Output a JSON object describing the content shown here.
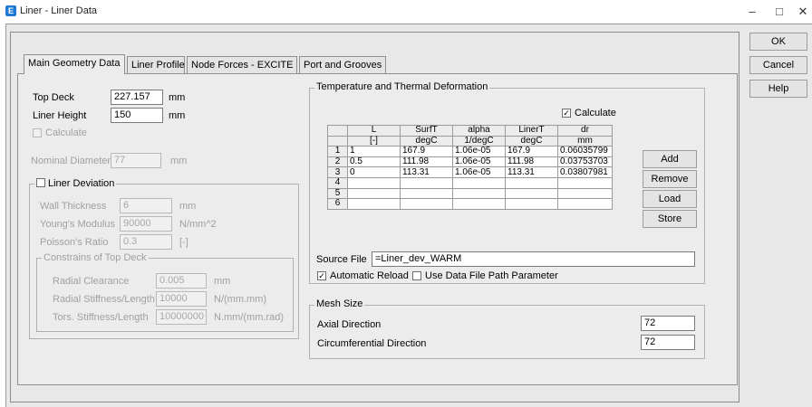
{
  "window": {
    "title": "Liner - Liner Data",
    "app_icon": "E",
    "controls": [
      "–",
      "□",
      "✕"
    ]
  },
  "side_buttons": {
    "ok": "OK",
    "cancel": "Cancel",
    "help": "Help"
  },
  "tabs": [
    "Main Geometry Data",
    "Liner Profile",
    "Node Forces - EXCITE",
    "Port and Grooves"
  ],
  "geometry": {
    "top_deck": {
      "label": "Top Deck",
      "value": "227.157",
      "unit": "mm"
    },
    "liner_height": {
      "label": "Liner Height",
      "value": "150",
      "unit": "mm"
    },
    "calculate": {
      "label": "Calculate"
    },
    "nominal_diameter": {
      "label": "Nominal Diameter",
      "value": "77",
      "unit": "mm"
    }
  },
  "liner_deviation": {
    "title": "Liner Deviation",
    "wall_thickness": {
      "label": "Wall Thickness",
      "value": "6",
      "unit": "mm"
    },
    "youngs_modulus": {
      "label": "Young's Modulus",
      "value": "90000",
      "unit": "N/mm^2"
    },
    "poissons_ratio": {
      "label": "Poisson's Ratio",
      "value": "0.3",
      "unit": "[-]"
    },
    "constraints": {
      "title": "Constrains of Top Deck",
      "radial_clearance": {
        "label": "Radial Clearance",
        "value": "0.005",
        "unit": "mm"
      },
      "radial_stiffness": {
        "label": "Radial Stiffness/Length",
        "value": "10000",
        "unit": "N/(mm.mm)"
      },
      "tors_stiffness": {
        "label": "Tors. Stiffness/Length",
        "value": "10000000",
        "unit": "N.mm/(mm.rad)"
      }
    }
  },
  "thermal": {
    "title": "Temperature and Thermal Deformation",
    "calculate_label": "Calculate",
    "calculate_checked": true,
    "columns": [
      {
        "name": "L",
        "unit": "[-]"
      },
      {
        "name": "SurfT",
        "unit": "degC"
      },
      {
        "name": "alpha",
        "unit": "1/degC"
      },
      {
        "name": "LinerT",
        "unit": "degC"
      },
      {
        "name": "dr",
        "unit": "mm"
      }
    ],
    "rows": [
      {
        "num": "1",
        "cells": [
          "1",
          "167.9",
          "1.06e-05",
          "167.9",
          "0.06035799"
        ]
      },
      {
        "num": "2",
        "cells": [
          "0.5",
          "111.98",
          "1.06e-05",
          "111.98",
          "0.03753703"
        ]
      },
      {
        "num": "3",
        "cells": [
          "0",
          "113.31",
          "1.06e-05",
          "113.31",
          "0.03807981"
        ]
      },
      {
        "num": "4",
        "cells": [
          "",
          "",
          "",
          "",
          ""
        ]
      },
      {
        "num": "5",
        "cells": [
          "",
          "",
          "",
          "",
          ""
        ]
      },
      {
        "num": "6",
        "cells": [
          "",
          "",
          "",
          "",
          ""
        ]
      }
    ],
    "buttons": {
      "add": "Add",
      "remove": "Remove",
      "load": "Load",
      "store": "Store"
    },
    "source_file": {
      "label": "Source File",
      "value": "=Liner_dev_WARM"
    },
    "automatic_reload": {
      "label": "Automatic Reload",
      "checked": true
    },
    "use_data_file_path": {
      "label": "Use Data File Path Parameter",
      "checked": false
    }
  },
  "mesh": {
    "title": "Mesh Size",
    "axial": {
      "label": "Axial Direction",
      "value": "72"
    },
    "circumferential": {
      "label": "Circumferential Direction",
      "value": "72"
    }
  }
}
